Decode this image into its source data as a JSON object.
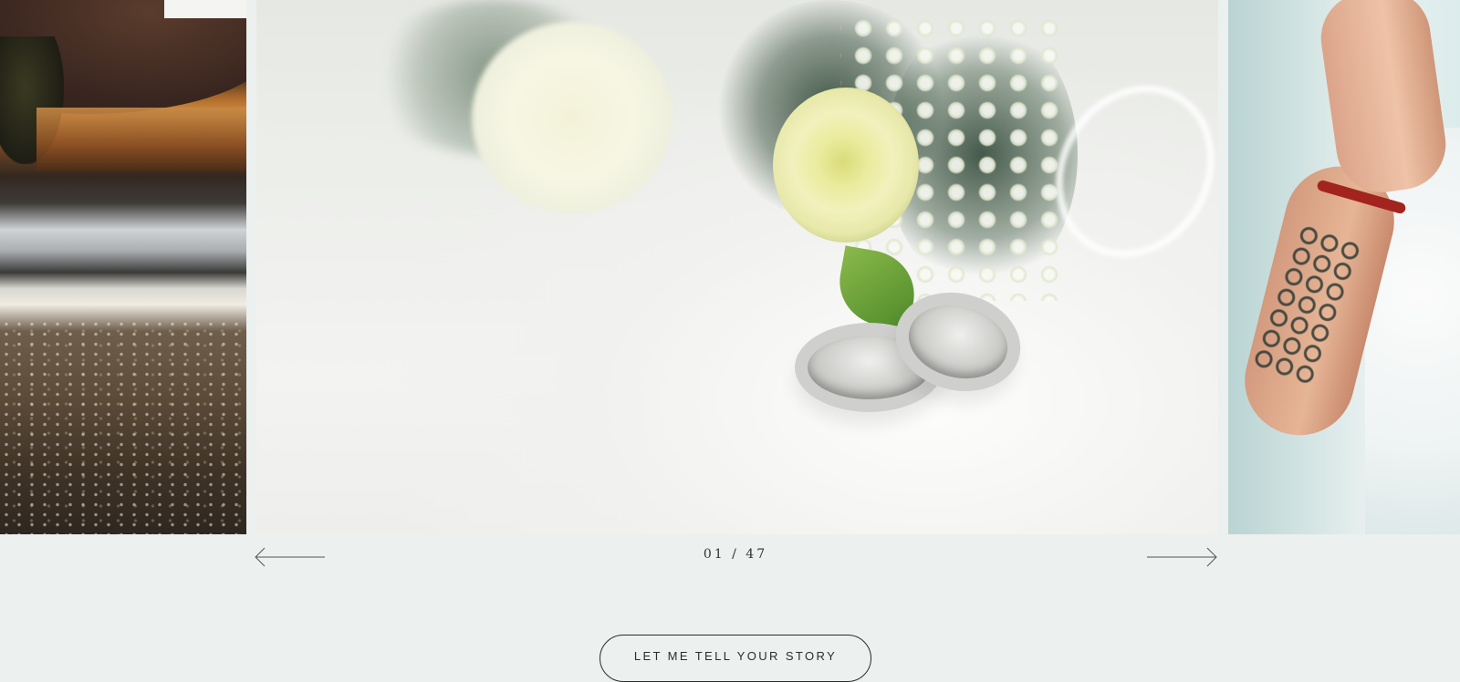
{
  "gallery": {
    "slides": [
      {
        "icon": "landscape-photo"
      },
      {
        "icon": "wedding-rings-bouquet-photo"
      },
      {
        "icon": "bride-arm-tattoo-photo"
      }
    ],
    "counter": {
      "current": "01",
      "separator": "/",
      "total": "47",
      "text": "01 / 47"
    },
    "prev_icon": "arrow-left-icon",
    "next_icon": "arrow-right-icon"
  },
  "cta": {
    "label": "LET ME TELL YOUR STORY"
  },
  "colors": {
    "background": "#ecf0ef",
    "text": "#333333",
    "button_border": "#2c2c2c"
  }
}
